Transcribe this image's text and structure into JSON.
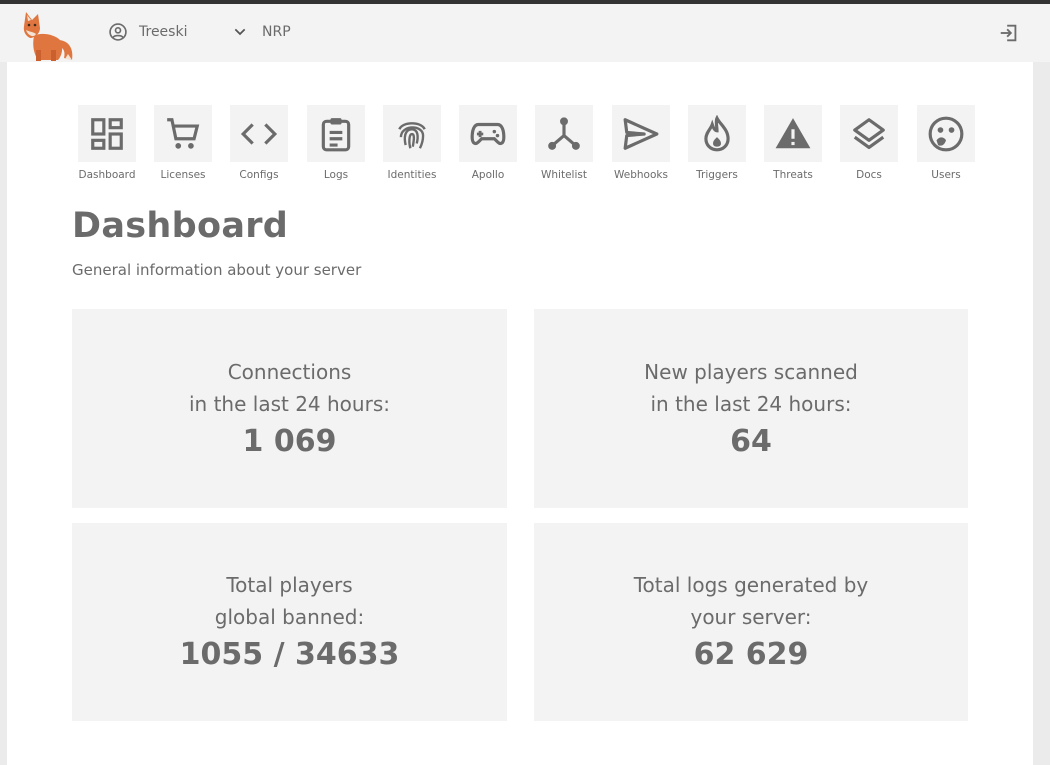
{
  "header": {
    "user_name": "Treeski",
    "server_name": "NRP"
  },
  "nav": {
    "items": [
      {
        "label": "Dashboard",
        "icon": "dashboard-icon"
      },
      {
        "label": "Licenses",
        "icon": "cart-icon"
      },
      {
        "label": "Configs",
        "icon": "code-icon"
      },
      {
        "label": "Logs",
        "icon": "clipboard-icon"
      },
      {
        "label": "Identities",
        "icon": "fingerprint-icon"
      },
      {
        "label": "Apollo",
        "icon": "gamepad-icon"
      },
      {
        "label": "Whitelist",
        "icon": "merge-icon"
      },
      {
        "label": "Webhooks",
        "icon": "send-icon"
      },
      {
        "label": "Triggers",
        "icon": "flame-icon"
      },
      {
        "label": "Threats",
        "icon": "warning-icon"
      },
      {
        "label": "Docs",
        "icon": "layers-icon"
      },
      {
        "label": "Users",
        "icon": "face-icon"
      }
    ]
  },
  "page": {
    "title": "Dashboard",
    "subtitle": "General information about your server"
  },
  "stats": [
    {
      "line1": "Connections",
      "line2": "in the last 24 hours:",
      "value": "1 069"
    },
    {
      "line1": "New players scanned",
      "line2": "in the last 24 hours:",
      "value": "64"
    },
    {
      "line1": "Total players",
      "line2": "global banned:",
      "value": "1055 / 34633"
    },
    {
      "line1": "Total logs generated by",
      "line2": "your server:",
      "value": "62 629"
    }
  ],
  "colors": {
    "text": "#6b6b6b",
    "tile": "#f3f3f3",
    "accent_fox": "#e0763f"
  }
}
